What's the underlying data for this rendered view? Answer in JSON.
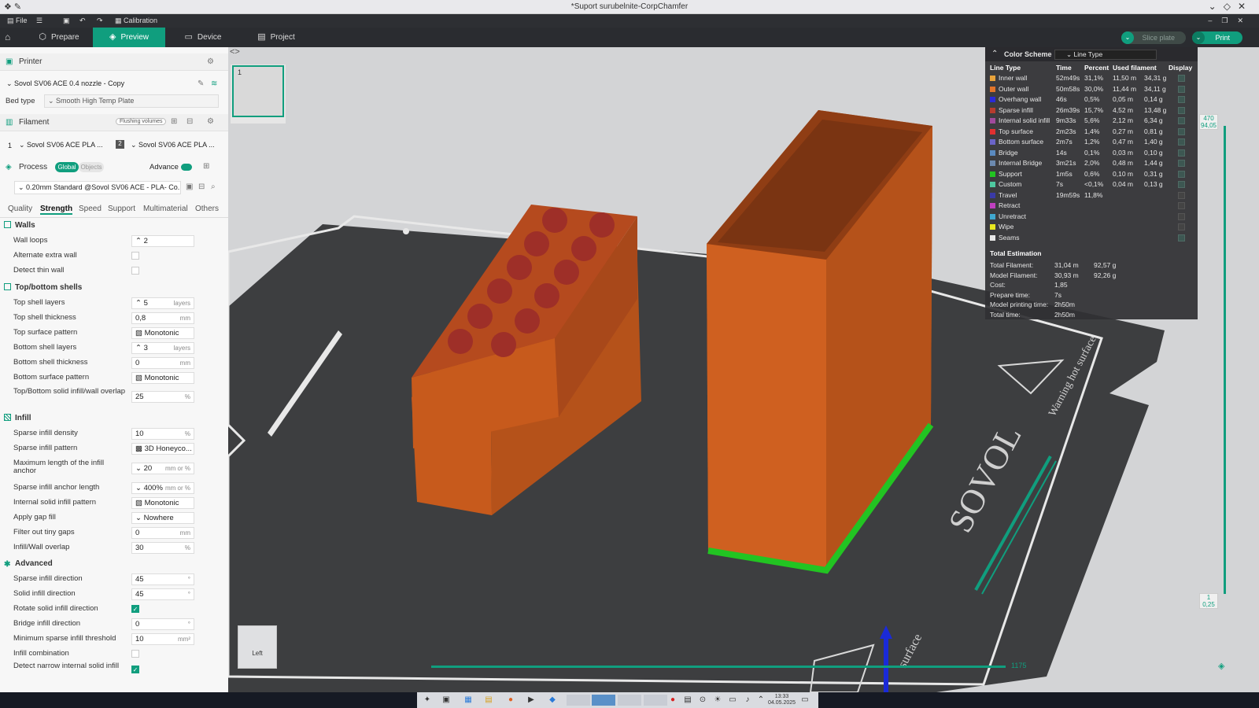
{
  "window": {
    "title": "*Suport surubelnite-CorpChamfer"
  },
  "menu": {
    "file": "File",
    "calibration": "Calibration"
  },
  "tabs": [
    {
      "label": "Prepare",
      "icon": "cube-icon"
    },
    {
      "label": "Preview",
      "icon": "layers-icon"
    },
    {
      "label": "Device",
      "icon": "monitor-icon"
    },
    {
      "label": "Project",
      "icon": "document-icon"
    }
  ],
  "actions": {
    "slice": "Slice plate",
    "print": "Print"
  },
  "printer": {
    "header": "Printer",
    "name": "Sovol SV06 ACE 0.4 nozzle - Copy",
    "bed_type_label": "Bed type",
    "bed_type": "Smooth High Temp Plate"
  },
  "filament": {
    "header": "Filament",
    "flushing": "Flushing volumes",
    "slots": [
      {
        "index": "1",
        "name": "Sovol SV06 ACE PLA ..."
      },
      {
        "index": "2",
        "name": "Sovol SV06 ACE PLA ..."
      }
    ]
  },
  "process": {
    "header": "Process",
    "global": "Global",
    "objects": "Objects",
    "advance": "Advance",
    "preset": "0.20mm Standard @Sovol SV06 ACE - PLA- Co..."
  },
  "subtabs": [
    "Quality",
    "Strength",
    "Speed",
    "Support",
    "Multimaterial",
    "Others"
  ],
  "settings": {
    "walls": "Walls",
    "wall_loops": {
      "label": "Wall loops",
      "value": "2"
    },
    "alternate_extra_wall": "Alternate extra wall",
    "detect_thin_wall": "Detect thin wall",
    "topbottom": "Top/bottom shells",
    "top_shell_layers": {
      "label": "Top shell layers",
      "value": "5",
      "unit": "layers"
    },
    "top_shell_thickness": {
      "label": "Top shell thickness",
      "value": "0,8",
      "unit": "mm"
    },
    "top_surface_pattern": {
      "label": "Top surface pattern",
      "value": "Monotonic"
    },
    "bottom_shell_layers": {
      "label": "Bottom shell layers",
      "value": "3",
      "unit": "layers"
    },
    "bottom_shell_thickness": {
      "label": "Bottom shell thickness",
      "value": "0",
      "unit": "mm"
    },
    "bottom_surface_pattern": {
      "label": "Bottom surface pattern",
      "value": "Monotonic"
    },
    "tb_overlap": {
      "label": "Top/Bottom solid infill/wall overlap",
      "value": "25",
      "unit": "%"
    },
    "infill": "Infill",
    "sparse_density": {
      "label": "Sparse infill density",
      "value": "10",
      "unit": "%"
    },
    "sparse_pattern": {
      "label": "Sparse infill pattern",
      "value": "3D Honeyco..."
    },
    "max_anchor": {
      "label": "Maximum length of the infill anchor",
      "value": "20",
      "unit": "mm or %"
    },
    "anchor_length": {
      "label": "Sparse infill anchor length",
      "value": "400%",
      "unit": "mm or %"
    },
    "internal_pattern": {
      "label": "Internal solid infill pattern",
      "value": "Monotonic"
    },
    "gap_fill": {
      "label": "Apply gap fill",
      "value": "Nowhere"
    },
    "tiny_gaps": {
      "label": "Filter out tiny gaps",
      "value": "0",
      "unit": "mm"
    },
    "infill_wall_overlap": {
      "label": "Infill/Wall overlap",
      "value": "30",
      "unit": "%"
    },
    "advanced": "Advanced",
    "sparse_dir": {
      "label": "Sparse infill direction",
      "value": "45",
      "unit": "°"
    },
    "solid_dir": {
      "label": "Solid infill direction",
      "value": "45",
      "unit": "°"
    },
    "rotate_solid": {
      "label": "Rotate solid infill direction",
      "checked": true
    },
    "bridge_dir": {
      "label": "Bridge infill direction",
      "value": "0",
      "unit": "°"
    },
    "min_sparse": {
      "label": "Minimum sparse infill threshold",
      "value": "10",
      "unit": "mm²"
    },
    "combination": {
      "label": "Infill combination"
    },
    "detect_narrow": {
      "label": "Detect narrow internal solid infill",
      "checked": true
    }
  },
  "color_scheme": {
    "title": "Color Scheme",
    "mode": "Line Type",
    "columns": [
      "Line Type",
      "Time",
      "Percent",
      "Used filament",
      "Display"
    ],
    "rows": [
      {
        "name": "Inner wall",
        "color": "#e8a33b",
        "time": "52m49s",
        "percent": "31,1%",
        "length": "11,50 m",
        "weight": "34,31 g",
        "display": true
      },
      {
        "name": "Outer wall",
        "color": "#e2752a",
        "time": "50m58s",
        "percent": "30,0%",
        "length": "11,44 m",
        "weight": "34,11 g",
        "display": true
      },
      {
        "name": "Overhang wall",
        "color": "#2a2ad8",
        "time": "46s",
        "percent": "0,5%",
        "length": "0,05 m",
        "weight": "0,14 g",
        "display": true
      },
      {
        "name": "Sparse infill",
        "color": "#b63c2e",
        "time": "26m39s",
        "percent": "15,7%",
        "length": "4,52 m",
        "weight": "13,48 g",
        "display": true
      },
      {
        "name": "Internal solid infill",
        "color": "#a04a9c",
        "time": "9m33s",
        "percent": "5,6%",
        "length": "2,12 m",
        "weight": "6,34 g",
        "display": true
      },
      {
        "name": "Top surface",
        "color": "#e03030",
        "time": "2m23s",
        "percent": "1,4%",
        "length": "0,27 m",
        "weight": "0,81 g",
        "display": true
      },
      {
        "name": "Bottom surface",
        "color": "#6a64c8",
        "time": "2m7s",
        "percent": "1,2%",
        "length": "0,47 m",
        "weight": "1,40 g",
        "display": true
      },
      {
        "name": "Bridge",
        "color": "#5a8ac0",
        "time": "14s",
        "percent": "0,1%",
        "length": "0,03 m",
        "weight": "0,10 g",
        "display": true
      },
      {
        "name": "Internal Bridge",
        "color": "#6c8ab0",
        "time": "3m21s",
        "percent": "2,0%",
        "length": "0,48 m",
        "weight": "1,44 g",
        "display": true
      },
      {
        "name": "Support",
        "color": "#22c422",
        "time": "1m5s",
        "percent": "0,6%",
        "length": "0,10 m",
        "weight": "0,31 g",
        "display": true
      },
      {
        "name": "Custom",
        "color": "#4ec9a0",
        "time": "7s",
        "percent": "<0,1%",
        "length": "0,04 m",
        "weight": "0,13 g",
        "display": true
      },
      {
        "name": "Travel",
        "color": "#3a3aa8",
        "time": "19m59s",
        "percent": "11,8%",
        "length": "",
        "weight": "",
        "display": false
      },
      {
        "name": "Retract",
        "color": "#c040c0",
        "time": "",
        "percent": "",
        "length": "",
        "weight": "",
        "display": false
      },
      {
        "name": "Unretract",
        "color": "#40a8d0",
        "time": "",
        "percent": "",
        "length": "",
        "weight": "",
        "display": false
      },
      {
        "name": "Wipe",
        "color": "#e8e820",
        "time": "",
        "percent": "",
        "length": "",
        "weight": "",
        "display": false
      },
      {
        "name": "Seams",
        "color": "#e8e8e8",
        "time": "",
        "percent": "",
        "length": "",
        "weight": "",
        "display": true
      }
    ],
    "estimation_title": "Total Estimation",
    "estimation": [
      {
        "label": "Total Filament:",
        "v1": "31,04 m",
        "v2": "92,57 g"
      },
      {
        "label": "Model Filament:",
        "v1": "30,93 m",
        "v2": "92,26 g"
      },
      {
        "label": "Cost:",
        "v1": "1,85",
        "v2": ""
      },
      {
        "label": "Prepare time:",
        "v1": "7s",
        "v2": ""
      },
      {
        "label": "Model printing time:",
        "v1": "2h50m",
        "v2": ""
      },
      {
        "label": "Total time:",
        "v1": "2h50m",
        "v2": ""
      }
    ]
  },
  "viewport": {
    "plate_number": "1",
    "layer_top": {
      "layer": "470",
      "height": "94,05"
    },
    "layer_bottom": {
      "layer": "1",
      "height": "0,25"
    },
    "move_value": "1175",
    "view_cube": "Left",
    "bed_brand": "SOVOL",
    "bed_warning": "Warning hot surface",
    "bed_surface": "surface"
  },
  "taskbar": {
    "time": "13:33",
    "date": "04.05.2025"
  }
}
